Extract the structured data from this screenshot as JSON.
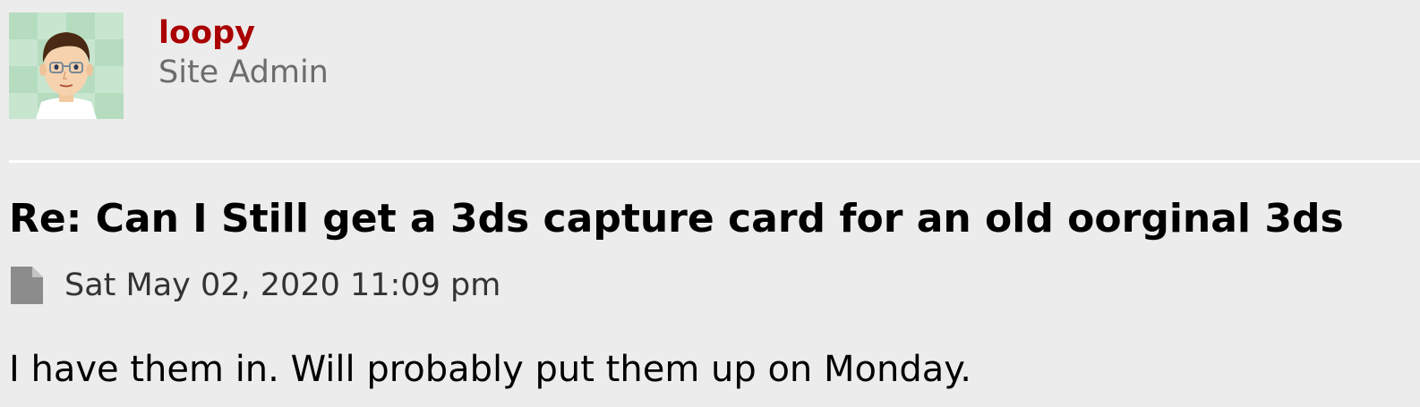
{
  "author": {
    "username": "loopy",
    "rank": "Site Admin",
    "username_color": "#aa0000",
    "avatar_icon": "mii-avatar-icon"
  },
  "post": {
    "title": "Re: Can I Still get a 3ds capture card for an old oorginal 3ds",
    "icon": "document-icon",
    "date": "Sat May 02, 2020 11:09 pm",
    "content": "I have them in. Will probably put them up on Monday."
  }
}
